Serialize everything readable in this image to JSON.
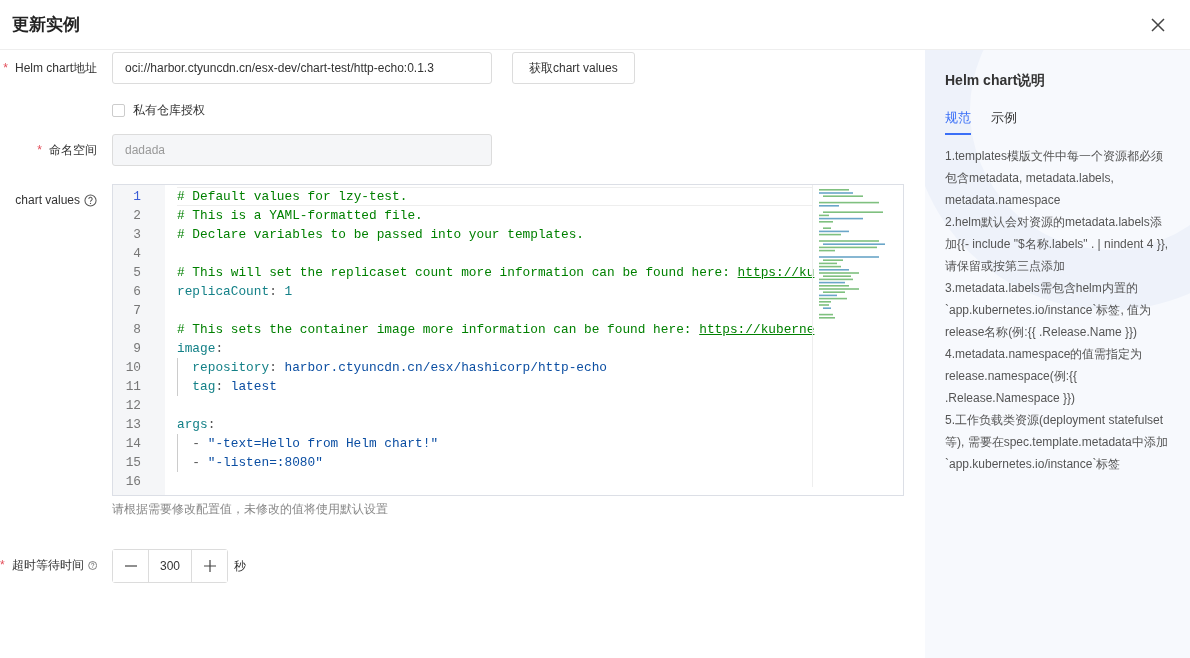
{
  "dialog": {
    "title": "更新实例"
  },
  "chart_address": {
    "label": "Helm chart地址",
    "required_mark": "*",
    "value": "oci://harbor.ctyuncdn.cn/esx-dev/chart-test/http-echo:0.1.3",
    "button": "获取chart values"
  },
  "private_registry": {
    "label": "私有仓库授权",
    "checked": false
  },
  "namespace": {
    "label": "命名空间",
    "required_mark": "*",
    "value": "dadada",
    "disabled": true
  },
  "chart_values": {
    "label": "chart values",
    "hint": "请根据需要修改配置值，未修改的值将使用默认设置",
    "lines": [
      {
        "number": "1",
        "active": true,
        "indented": false,
        "segments": [
          {
            "kind": "comment",
            "text": "# Default values for lzy-test."
          }
        ]
      },
      {
        "number": "2",
        "active": false,
        "indented": false,
        "segments": [
          {
            "kind": "comment",
            "text": "# This is a YAML-formatted file."
          }
        ]
      },
      {
        "number": "3",
        "active": false,
        "indented": false,
        "segments": [
          {
            "kind": "comment",
            "text": "# Declare variables to be passed into your templates."
          }
        ]
      },
      {
        "number": "4",
        "active": false
      },
      {
        "number": "5",
        "active": false,
        "indented": false,
        "segments": [
          {
            "kind": "comment",
            "text": "# This will set the replicaset count more information can be found here: "
          },
          {
            "kind": "link",
            "text": "https://ku"
          }
        ]
      },
      {
        "number": "6",
        "active": false,
        "indented": false,
        "segments": [
          {
            "kind": "key",
            "text": "replicaCount"
          },
          {
            "kind": "punct",
            "text": ": "
          },
          {
            "kind": "number",
            "text": "1"
          }
        ]
      },
      {
        "number": "7",
        "active": false
      },
      {
        "number": "8",
        "active": false,
        "indented": false,
        "segments": [
          {
            "kind": "comment",
            "text": "# This sets the container image more information can be found here: "
          },
          {
            "kind": "link",
            "text": "https://kuberne"
          }
        ]
      },
      {
        "number": "9",
        "active": false,
        "indented": false,
        "segments": [
          {
            "kind": "key",
            "text": "image"
          },
          {
            "kind": "punct",
            "text": ":"
          }
        ]
      },
      {
        "number": "10",
        "active": false,
        "indented": true,
        "segments": [
          {
            "kind": "key",
            "text": "repository"
          },
          {
            "kind": "punct",
            "text": ": "
          },
          {
            "kind": "string",
            "text": "harbor.ctyuncdn.cn/esx/hashicorp/http-echo"
          }
        ]
      },
      {
        "number": "11",
        "active": false,
        "indented": true,
        "segments": [
          {
            "kind": "key",
            "text": "tag"
          },
          {
            "kind": "punct",
            "text": ": "
          },
          {
            "kind": "string",
            "text": "latest"
          }
        ]
      },
      {
        "number": "12",
        "active": false
      },
      {
        "number": "13",
        "active": false,
        "indented": false,
        "segments": [
          {
            "kind": "key",
            "text": "args"
          },
          {
            "kind": "punct",
            "text": ":"
          }
        ]
      },
      {
        "number": "14",
        "active": false,
        "indented": true,
        "segments": [
          {
            "kind": "punct",
            "text": "- "
          },
          {
            "kind": "string",
            "text": "\"-text=Hello from Helm chart!\""
          }
        ]
      },
      {
        "number": "15",
        "active": false,
        "indented": true,
        "segments": [
          {
            "kind": "punct",
            "text": "- "
          },
          {
            "kind": "string",
            "text": "\"-listen=:8080\""
          }
        ]
      },
      {
        "number": "16",
        "active": false
      }
    ]
  },
  "timeout": {
    "label": "超时等待时间",
    "required_mark": "*",
    "value": "300",
    "unit": "秒"
  },
  "side_panel": {
    "title": "Helm chart说明",
    "tabs": [
      {
        "label": "规范",
        "selected": true
      },
      {
        "label": "示例",
        "selected": false
      }
    ],
    "rules": [
      "1.templates模版文件中每一个资源都必须包含metadata, metadata.labels, metadata.namespace",
      "2.helm默认会对资源的metadata.labels添加{{- include \"$名称.labels\" . | nindent 4 }}, 请保留或按第三点添加",
      "3.metadata.labels需包含helm内置的`app.kubernetes.io/instance`标签, 值为release名称(例:{{ .Release.Name }})",
      "4.metadata.namespace的值需指定为release.namespace(例:{{ .Release.Namespace }})",
      "5.工作负载类资源(deployment statefulset等), 需要在spec.template.metadata中添加`app.kubernetes.io/instance`标签"
    ]
  }
}
